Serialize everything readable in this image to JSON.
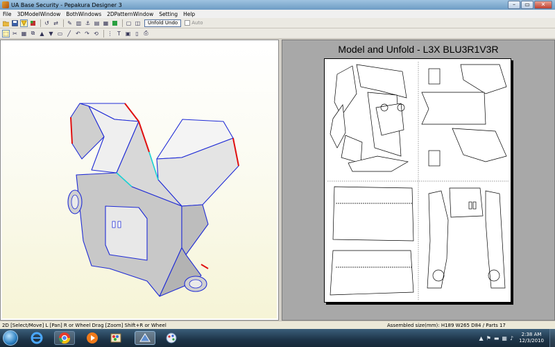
{
  "window": {
    "title": "UA Base Security - Pepakura Designer 3",
    "minimize_glyph": "–",
    "maximize_glyph": "▭",
    "close_glyph": "✕"
  },
  "menu": [
    "File",
    "3DModelWindow",
    "BothWindows",
    "2DPatternWindow",
    "Setting",
    "Help"
  ],
  "toolbar1": {
    "unfold_undo_label": "Unfold Undo",
    "auto_label": "Auto"
  },
  "pattern_window": {
    "title": "Model and Unfold - L3X BLU3R1V3R"
  },
  "status": {
    "left": "2D [Select/Move] L [Pan] R or Wheel Drag [Zoom] Shift+R or Wheel",
    "right": "Assembled size(mm): H189 W265 D84 / Parts 17"
  },
  "taskbar": {
    "time": "2:38 AM",
    "date": "12/3/2010",
    "icons": [
      "start-orb",
      "internet-explorer-icon",
      "chrome-icon",
      "media-player-icon",
      "paint-icon",
      "pepakura-icon",
      "paint-net-icon"
    ]
  },
  "colors": {
    "edge_blue": "#1f2bd6",
    "edge_red": "#e01010",
    "edge_cyan": "#19d3d3",
    "model_face": "#e6e6e6",
    "model_face_dark": "#c6c6c6",
    "pane_bg": "#a8a8a8"
  }
}
